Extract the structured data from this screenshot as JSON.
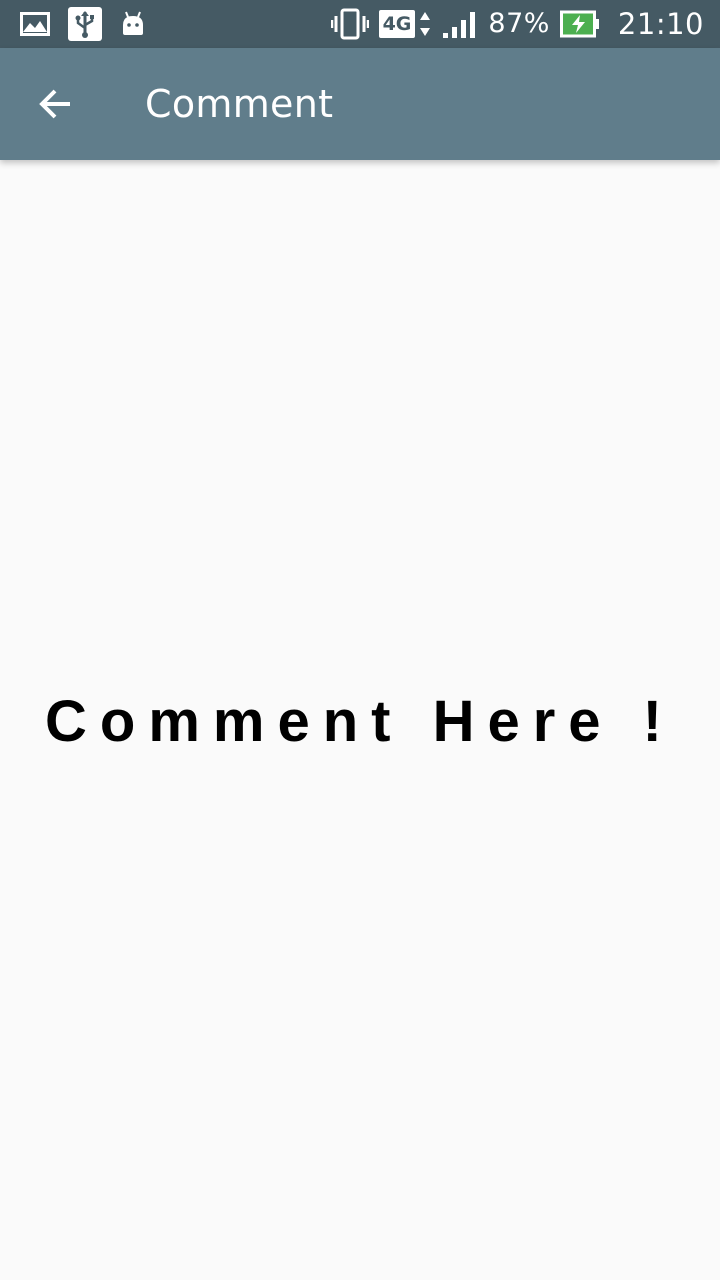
{
  "status_bar": {
    "icons_left": [
      "gallery-icon",
      "usb-icon",
      "android-icon"
    ],
    "vibrate_icon": "vibrate-icon",
    "network_label": "4G",
    "signal_icon": "signal-icon",
    "battery_percent": "87%",
    "battery_icon": "battery-charging-icon",
    "time": "21:10",
    "colors": {
      "background": "#455a64",
      "battery_fill": "#4caf50"
    }
  },
  "app_bar": {
    "back_icon": "arrow-back-icon",
    "title": "Comment",
    "color": "#607d8b"
  },
  "main": {
    "placeholder_text": "Comment Here !"
  }
}
